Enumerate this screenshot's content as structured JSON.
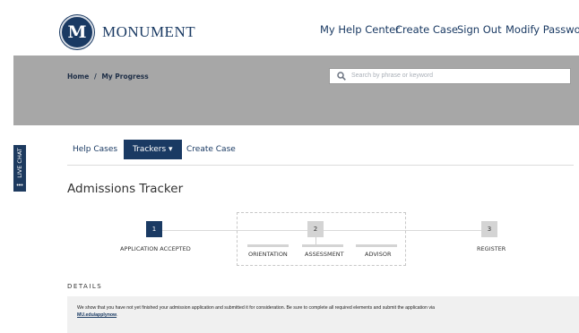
{
  "brand": {
    "name": "MONUMENT",
    "seal_letter": "M"
  },
  "nav": {
    "my_help_center": "My Help Center",
    "create_case": "Create Case",
    "sign_out": "Sign Out",
    "modify_password": "Modify Password"
  },
  "breadcrumb": {
    "home": "Home",
    "separator": "/",
    "current": "My Progress"
  },
  "search": {
    "placeholder": "Search by phrase or keyword"
  },
  "live_chat": {
    "label": "LIVE CHAT",
    "more": "•••"
  },
  "tabs": {
    "help_cases": "Help Cases",
    "trackers": "Trackers ▾",
    "create_case": "Create Case"
  },
  "page_title": "Admissions Tracker",
  "tracker": {
    "steps": [
      {
        "number": "1",
        "label": "APPLICATION ACCEPTED",
        "status": "complete"
      },
      {
        "number": "2",
        "label": "",
        "status": "pending"
      },
      {
        "number": "3",
        "label": "REGISTER",
        "status": "pending"
      }
    ],
    "substeps": [
      "ORIENTATION",
      "ASSESSMENT",
      "ADVISOR"
    ]
  },
  "details": {
    "heading": "DETAILS",
    "text": "We show that you have not yet finished your admission application and submitted it for consideration. Be sure to complete all required elements and submit the application via",
    "link": "MU.edu/applynow",
    "end": "."
  },
  "colors": {
    "brand_navy": "#1a3a63",
    "band_grey": "#a7a7a7",
    "panel_grey": "#f0f0f0"
  }
}
